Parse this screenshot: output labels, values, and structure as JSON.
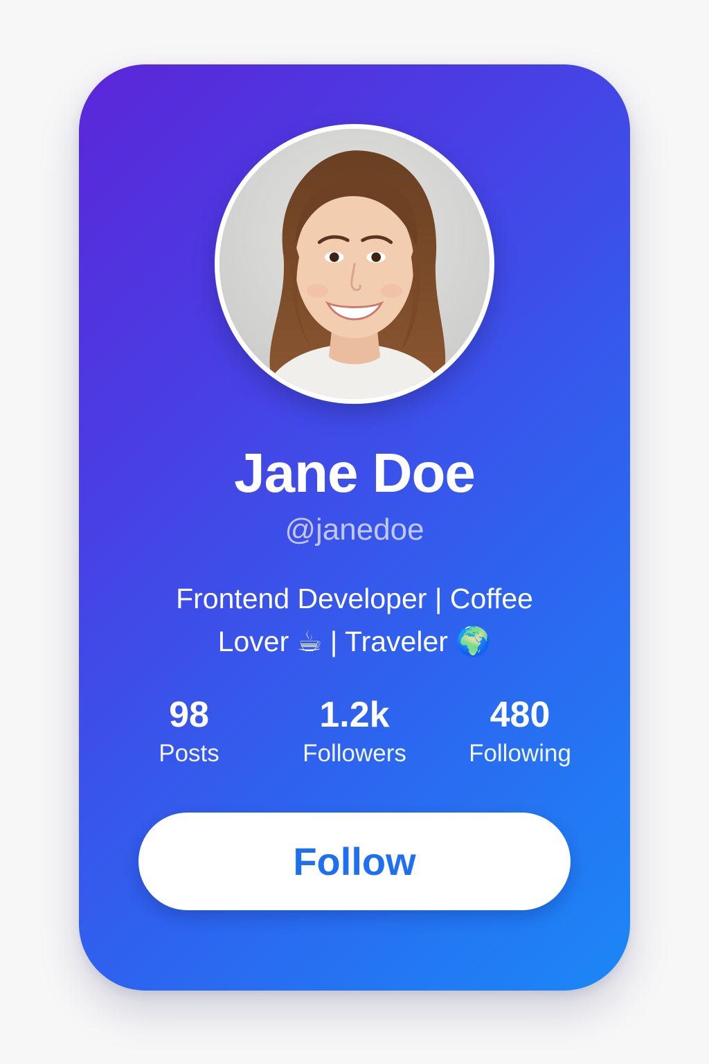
{
  "profile": {
    "avatar_icon": "profile-photo",
    "name": "Jane Doe",
    "handle": "@janedoe",
    "bio": "Frontend Developer | Coffee Lover ☕ | Traveler 🌍"
  },
  "stats": [
    {
      "value": "98",
      "label": "Posts"
    },
    {
      "value": "1.2k",
      "label": "Followers"
    },
    {
      "value": "480",
      "label": "Following"
    }
  ],
  "actions": {
    "follow_label": "Follow"
  },
  "colors": {
    "gradient_start": "#5b26d8",
    "gradient_end": "#1b88f7",
    "button_text": "#1f6ff2",
    "page_background": "#f7f7f8"
  }
}
